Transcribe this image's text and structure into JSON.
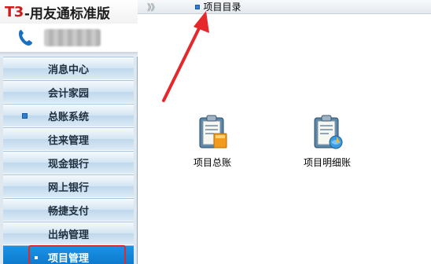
{
  "brand": {
    "prefix": "T3",
    "name": "-用友通标准版"
  },
  "menu": [
    {
      "label": "消息中心",
      "bullet": false,
      "active": false
    },
    {
      "label": "会计家园",
      "bullet": false,
      "active": false
    },
    {
      "label": "总账系统",
      "bullet": true,
      "active": false
    },
    {
      "label": "往来管理",
      "bullet": false,
      "active": false
    },
    {
      "label": "现金银行",
      "bullet": false,
      "active": false
    },
    {
      "label": "网上银行",
      "bullet": false,
      "active": false
    },
    {
      "label": "畅捷支付",
      "bullet": false,
      "active": false
    },
    {
      "label": "出纳管理",
      "bullet": false,
      "active": false
    },
    {
      "label": "项目管理",
      "bullet": true,
      "active": true
    }
  ],
  "topbar": {
    "toggle": "》》",
    "breadcrumb": "项目目录"
  },
  "items": [
    {
      "label": "项目总账",
      "icon": "ledger-clipboard-icon"
    },
    {
      "label": "项目明细账",
      "icon": "detail-ledger-clipboard-icon"
    }
  ],
  "colors": {
    "active": "#0b74c8",
    "highlight": "#e5282b",
    "brand_red": "#cc1d1d"
  }
}
